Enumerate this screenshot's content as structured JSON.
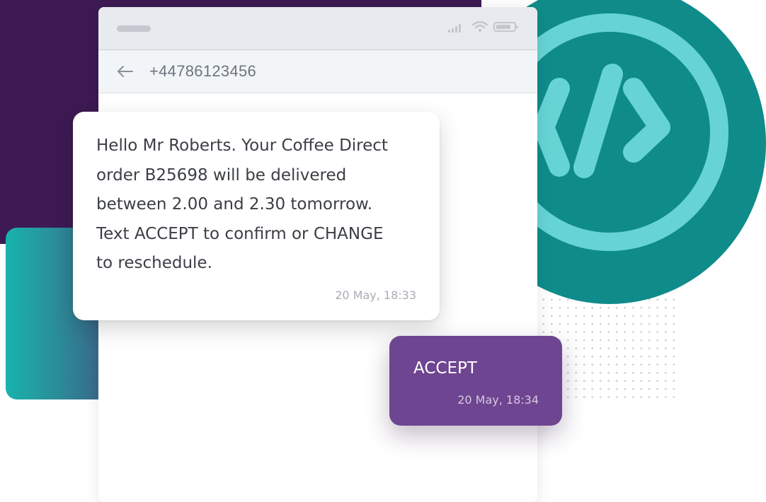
{
  "theme": {
    "background_purple": "#3d1a52",
    "teal": "#0f8c8a",
    "teal_light": "#66d4d4",
    "outgoing_bubble": "#6e4590",
    "incoming_bubble": "#ffffff"
  },
  "icons": {
    "status_bar": [
      "signal-icon",
      "wifi-icon",
      "battery-icon"
    ],
    "header": "back-arrow-icon",
    "decoration": "code-icon"
  },
  "conversation": {
    "contact_number": "+44786123456",
    "messages": [
      {
        "direction": "incoming",
        "lines": [
          "Hello Mr Roberts. Your Coffee Direct",
          "order B25698 will be delivered",
          "between 2.00 and 2.30 tomorrow.",
          "Text ACCEPT to confirm or CHANGE",
          "to reschedule."
        ],
        "timestamp": "20 May, 18:33"
      },
      {
        "direction": "outgoing",
        "text": "ACCEPT",
        "timestamp": "20 May, 18:34"
      }
    ]
  }
}
